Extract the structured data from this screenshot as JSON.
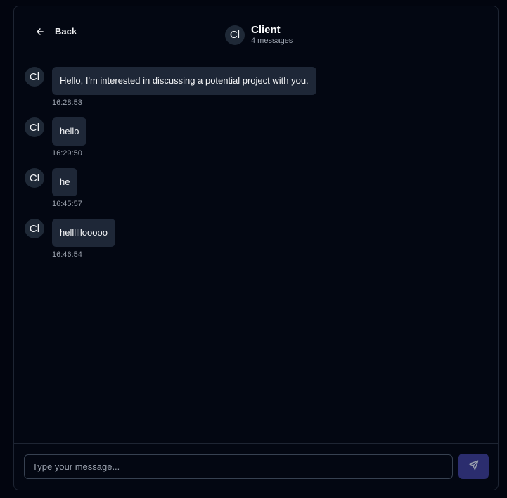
{
  "header": {
    "back_label": "Back",
    "avatar_initials": "Cl",
    "title": "Client",
    "subtitle": "4 messages"
  },
  "messages": [
    {
      "avatar": "Cl",
      "text": "Hello, I'm interested in discussing a potential project with you.",
      "time": "16:28:53"
    },
    {
      "avatar": "Cl",
      "text": "hello",
      "time": "16:29:50"
    },
    {
      "avatar": "Cl",
      "text": "he",
      "time": "16:45:57"
    },
    {
      "avatar": "Cl",
      "text": "hellllllooooo",
      "time": "16:46:54"
    }
  ],
  "composer": {
    "placeholder": "Type your message...",
    "value": "",
    "send_icon": "send-icon"
  },
  "colors": {
    "background": "#030712",
    "bubble": "#1e2737",
    "send_button": "#2b2d6e"
  }
}
